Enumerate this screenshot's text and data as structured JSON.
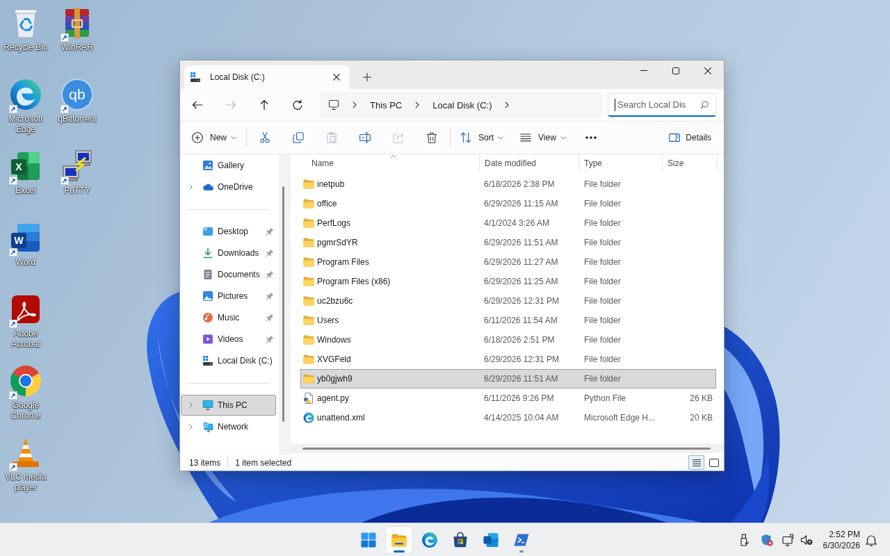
{
  "desktop": {
    "columns": [
      [
        {
          "label": "Recycle Bin",
          "kind": "recycle-bin",
          "shortcut": false
        },
        {
          "label": "Microsoft Edge",
          "kind": "swirl",
          "shortcut": true
        },
        {
          "label": "Excel",
          "kind": "spreadsheet",
          "glyph": "X",
          "shortcut": true
        },
        {
          "label": "Word",
          "kind": "document",
          "glyph": "W",
          "shortcut": true
        },
        {
          "label": "Adobe Acrobat",
          "kind": "pdf",
          "shortcut": true
        },
        {
          "label": "Google Chrome",
          "kind": "browser",
          "shortcut": true
        },
        {
          "label": "VLC media player",
          "kind": "cone",
          "shortcut": true
        }
      ],
      [
        {
          "label": "WinRAR",
          "kind": "archive",
          "shortcut": true
        },
        {
          "label": "qBittorrent",
          "kind": "torrent",
          "glyph": "qb",
          "shortcut": true
        },
        {
          "label": "PuTTY",
          "kind": "terminal",
          "shortcut": true
        }
      ]
    ]
  },
  "window": {
    "tabs": [
      {
        "title": "Local Disk (C:)",
        "selected": true
      }
    ],
    "nav": [
      {
        "kind": "back",
        "disabled": false
      },
      {
        "kind": "forward",
        "disabled": true
      },
      {
        "kind": "up",
        "disabled": false
      },
      {
        "kind": "refresh",
        "disabled": false
      }
    ],
    "breadcrumb": [
      "This PC",
      "Local Disk (C:)"
    ],
    "search": {
      "placeholder": "Search Local Dis",
      "focused": true
    },
    "toolbar": {
      "groups": [
        [
          {
            "kind": "new",
            "label": "New",
            "dropdown": true,
            "disabled": false
          }
        ],
        [
          {
            "kind": "cut",
            "dropdown": false,
            "disabled": false
          },
          {
            "kind": "copy",
            "dropdown": false,
            "disabled": false
          },
          {
            "kind": "paste",
            "dropdown": false,
            "disabled": true
          },
          {
            "kind": "rename",
            "dropdown": false,
            "disabled": false
          },
          {
            "kind": "share",
            "dropdown": false,
            "disabled": true
          },
          {
            "kind": "delete",
            "dropdown": false,
            "disabled": false
          }
        ],
        [
          {
            "kind": "sort",
            "label": "Sort",
            "dropdown": true,
            "disabled": false
          },
          {
            "kind": "view",
            "label": "View",
            "dropdown": true,
            "disabled": false
          },
          {
            "kind": "more",
            "dropdown": false,
            "disabled": false
          }
        ]
      ],
      "details": {
        "label": "Details"
      }
    },
    "sidebar": {
      "sections": [
        [
          {
            "label": "Gallery",
            "kind": "gallery",
            "expandable": false,
            "pinned": false,
            "selected": false
          },
          {
            "label": "OneDrive",
            "kind": "cloud",
            "expandable": true,
            "pinned": false,
            "selected": false
          }
        ],
        [
          {
            "label": "Desktop",
            "kind": "desktop",
            "expandable": false,
            "pinned": true,
            "selected": false
          },
          {
            "label": "Downloads",
            "kind": "downloads",
            "expandable": false,
            "pinned": true,
            "selected": false
          },
          {
            "label": "Documents",
            "kind": "documents",
            "expandable": false,
            "pinned": true,
            "selected": false
          },
          {
            "label": "Pictures",
            "kind": "pictures",
            "expandable": false,
            "pinned": true,
            "selected": false
          },
          {
            "label": "Music",
            "kind": "music",
            "expandable": false,
            "pinned": true,
            "selected": false
          },
          {
            "label": "Videos",
            "kind": "videos",
            "expandable": false,
            "pinned": true,
            "selected": false
          },
          {
            "label": "Local Disk (C:)",
            "kind": "drive",
            "expandable": false,
            "pinned": false,
            "selected": false
          }
        ],
        [
          {
            "label": "This PC",
            "kind": "computer",
            "expandable": true,
            "pinned": false,
            "selected": true
          },
          {
            "label": "Network",
            "kind": "network",
            "expandable": true,
            "pinned": false,
            "selected": false
          }
        ]
      ]
    },
    "files": {
      "columns": [
        {
          "label": "Name",
          "sorted": true
        },
        {
          "label": "Date modified",
          "sorted": false
        },
        {
          "label": "Type",
          "sorted": false
        },
        {
          "label": "Size",
          "sorted": false
        }
      ],
      "rows": [
        {
          "name": "inetpub",
          "date": "6/18/2026 2:38 PM",
          "type": "File folder",
          "kind": "folder",
          "selected": false
        },
        {
          "name": "office",
          "date": "6/29/2026 11:15 AM",
          "type": "File folder",
          "kind": "folder",
          "selected": false
        },
        {
          "name": "PerfLogs",
          "date": "4/1/2024 3:26 AM",
          "type": "File folder",
          "kind": "folder",
          "selected": false
        },
        {
          "name": "pgmrSdYR",
          "date": "6/29/2026 11:51 AM",
          "type": "File folder",
          "kind": "folder",
          "selected": false
        },
        {
          "name": "Program Files",
          "date": "6/29/2026 11:27 AM",
          "type": "File folder",
          "kind": "folder",
          "selected": false
        },
        {
          "name": "Program Files (x86)",
          "date": "6/29/2026 11:25 AM",
          "type": "File folder",
          "kind": "folder",
          "selected": false
        },
        {
          "name": "uc2bzu6c",
          "date": "6/29/2026 12:31 PM",
          "type": "File folder",
          "kind": "folder",
          "selected": false
        },
        {
          "name": "Users",
          "date": "6/11/2026 11:54 AM",
          "type": "File folder",
          "kind": "folder",
          "selected": false
        },
        {
          "name": "Windows",
          "date": "6/18/2026 2:51 PM",
          "type": "File folder",
          "kind": "folder",
          "selected": false
        },
        {
          "name": "XVGFeld",
          "date": "6/29/2026 12:31 PM",
          "type": "File folder",
          "kind": "folder",
          "selected": false
        },
        {
          "name": "yb0gjwh9",
          "date": "6/29/2026 11:51 AM",
          "type": "File folder",
          "kind": "folder",
          "selected": true
        },
        {
          "name": "agent.py",
          "date": "6/11/2026 9:26 PM",
          "type": "Python File",
          "size": "26 KB",
          "kind": "script",
          "selected": false
        },
        {
          "name": "unattend.xml",
          "date": "4/14/2025 10:04 AM",
          "type": "Microsoft Edge H...",
          "size": "20 KB",
          "kind": "web",
          "selected": false
        }
      ]
    },
    "status_bar": {
      "item_count": "13 items",
      "selection": "1 item selected",
      "views": [
        {
          "kind": "details",
          "selected": true
        },
        {
          "kind": "tiles",
          "selected": false
        }
      ]
    }
  },
  "taskbar": {
    "apps": [
      {
        "kind": "start",
        "selected": false,
        "running": false
      },
      {
        "kind": "folder",
        "selected": true,
        "running": true
      },
      {
        "kind": "swirl",
        "selected": false,
        "running": false
      },
      {
        "kind": "store",
        "selected": false,
        "running": false
      },
      {
        "kind": "mail",
        "selected": false,
        "running": false
      },
      {
        "kind": "terminal",
        "selected": false,
        "running": true
      }
    ],
    "clock": {
      "time": "2:52 PM",
      "date": "6/30/2026"
    }
  }
}
